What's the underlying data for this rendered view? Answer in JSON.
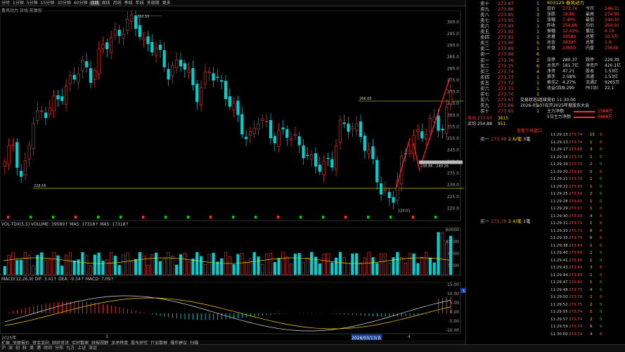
{
  "toolbar": {
    "items": [
      "分时",
      "1分钟",
      "5分钟",
      "15分钟",
      "30分钟",
      "60分钟",
      "日线",
      "周线",
      "月线",
      "季线",
      "年线",
      "多周期",
      "更多"
    ],
    "active": "日线"
  },
  "chart_title": "鲁风动力 日线 前复权",
  "price_axis": [
    "300.0",
    "295.0",
    "290.0",
    "285.0",
    "280.0",
    "275.0",
    "270.0",
    "265.0",
    "260.0",
    "255.0",
    "250.0",
    "245.0",
    "240.0",
    "235.0",
    "230.0",
    "225.0",
    "220.0"
  ],
  "annotations": {
    "high": "302.55",
    "low": "220.01",
    "level_266": "266.00",
    "level_228": "228.56",
    "range": "238.86 - 240.26"
  },
  "volume": {
    "header": "VOL-TDX(5,5) VOLUME: 39589↑  MA5: 17318↑  MA5: 17318↑",
    "axis": [
      "60000",
      "45000",
      "30000",
      "15000"
    ]
  },
  "macd": {
    "header": "MACD(12,26,9) DIF: 3.41↑  DEA: -0.54↑  MACD: 7.09↑",
    "axis": [
      "15.00",
      "10.00",
      "5.00",
      "0.00",
      "-5.00",
      "-10.00"
    ],
    "highlight": "5.56"
  },
  "dates": [
    "2025年",
    "3",
    "2026/03/13/五",
    "4"
  ],
  "tabs": [
    "扩展",
    "关联报价",
    "资金流向",
    "财经资讯",
    "实时数据",
    "财报视野",
    "龙虎榜单",
    "股东研究",
    "行业数据",
    "操作建议",
    "扫描"
  ],
  "header_right": {
    "code": "603129",
    "name": "春风动力"
  },
  "sell_orders": [
    {
      "label": "卖十",
      "price": "273.87",
      "vol": "1"
    },
    {
      "label": "卖九",
      "price": "273.86",
      "vol": "1"
    },
    {
      "label": "卖八",
      "price": "273.85",
      "vol": "3"
    },
    {
      "label": "卖七",
      "price": "273.95",
      "vol": "1"
    },
    {
      "label": "卖六",
      "price": "273.93",
      "vol": "1"
    },
    {
      "label": "卖五",
      "price": "273.92",
      "vol": "1"
    },
    {
      "label": "卖四",
      "price": "273.91",
      "vol": "1"
    },
    {
      "label": "卖三",
      "price": "273.90",
      "vol": "5"
    },
    {
      "label": "卖二",
      "price": "273.89",
      "vol": "1"
    },
    {
      "label": "卖一",
      "price": "273.88",
      "vol": "6"
    }
  ],
  "buy_orders": [
    {
      "label": "买一",
      "price": "273.76",
      "vol": "2"
    },
    {
      "label": "买二",
      "price": "273.75",
      "vol": "6"
    },
    {
      "label": "买三",
      "price": "273.74",
      "vol": "4"
    },
    {
      "label": "买四",
      "price": "273.73",
      "vol": "1"
    },
    {
      "label": "买五",
      "price": "273.72",
      "vol": "1"
    },
    {
      "label": "买六",
      "price": "273.71",
      "vol": "1"
    },
    {
      "label": "买七",
      "price": "273.70",
      "vol": "1"
    },
    {
      "label": "买八",
      "price": "273.67",
      "vol": "1"
    },
    {
      "label": "买九",
      "price": "273.66",
      "vol": "1"
    },
    {
      "label": "买十",
      "price": "273.65",
      "vol": "1"
    }
  ],
  "quote": [
    {
      "k": "现价",
      "v": "273.74",
      "k2": "今开",
      "v2": "246.31"
    },
    {
      "k": "涨跌",
      "v": "18.86",
      "k2": "最高",
      "v2": "274.99"
    },
    {
      "k": "涨幅",
      "v": "7.40%",
      "k2": "最低",
      "v2": "244.33"
    },
    {
      "k": "昨收",
      "v": "254.88",
      "k2": "均价",
      "v2": "264.91"
    },
    {
      "k": "振幅",
      "v": "12.43%",
      "k2": "量比",
      "v2": "6.19"
    },
    {
      "k": "总量",
      "v": "39589",
      "k2": "总笔",
      "v2": "10.5万"
    },
    {
      "k": "总金",
      "v": "28393",
      "k2": "总笔",
      "v2": "1.9"
    },
    {
      "k": "外盘",
      "v": "23950",
      "k2": "内盘",
      "v2": "15639"
    }
  ],
  "quote2": [
    {
      "k": "涨停",
      "v": "280.37",
      "k2": "跌停",
      "v2": "229.39"
    },
    {
      "k": "总资产",
      "v": "181.7亿",
      "k2": "净资产",
      "v2": "420.1亿"
    },
    {
      "k": "净资",
      "v": "47.21",
      "k2": "股本",
      "v2": "1.53亿"
    },
    {
      "k": "换手",
      "v": "2.58%",
      "k2": "流通",
      "v2": "1.53亿"
    },
    {
      "k": "换手Z",
      "v": "4.27%",
      "k2": "流通Z",
      "v2": "9265万"
    },
    {
      "k": "收益(四)",
      "v": "9.290",
      "k2": "PE(动)",
      "v2": "22.1"
    }
  ],
  "news": [
    "交易状态:连续竞价 11:30:00",
    "2026-05-07召开2025年度股东大会"
  ],
  "flow": [
    {
      "k": "主力净额",
      "v": "1588万"
    },
    {
      "k": "5日主力净额",
      "v": "6868万"
    }
  ],
  "summary": {
    "sell": "卖出 273.60",
    "sell_vol": "3615",
    "buy": "买均 254.88",
    "buy_vol": "951",
    "up": "↑",
    "tip": "查看千档盘口"
  },
  "level1": {
    "label": "卖一",
    "price": "273.88",
    "vol": "2.6/笔",
    "count": "3笔"
  },
  "level2": {
    "label": "买一",
    "price": "273.76",
    "vol": "2.4/笔",
    "count": "1笔"
  },
  "ticks": [
    {
      "t": "11:29:13",
      "p": "273.74",
      "v": "15",
      "d": "B"
    },
    {
      "t": "11:29:13",
      "p": "273.74",
      "v": "1",
      "d": "B"
    },
    {
      "t": "11:29:17",
      "p": "273.68",
      "v": "3",
      "d": "B"
    },
    {
      "t": "11:29:18",
      "p": "273.70",
      "v": "1",
      "d": "S"
    },
    {
      "t": "11:29:19",
      "p": "273.70",
      "v": "2",
      "d": "S"
    },
    {
      "t": "11:29:20",
      "p": "273.80",
      "v": "5",
      "d": "B"
    },
    {
      "t": "11:29:21",
      "p": "273.78",
      "v": "1",
      "d": "S"
    },
    {
      "t": "11:29:22",
      "p": "273.69",
      "v": "1",
      "d": "S"
    },
    {
      "t": "11:29:25",
      "p": "273.69",
      "v": "2",
      "d": "S"
    },
    {
      "t": "11:29:28",
      "p": "273.65",
      "v": "1",
      "d": "S"
    },
    {
      "t": "11:29:29",
      "p": "273.67",
      "v": "1",
      "d": "B"
    },
    {
      "t": "11:29:30",
      "p": "273.69",
      "v": "4",
      "d": "B"
    },
    {
      "t": "11:29:31",
      "p": "273.71",
      "v": "1",
      "d": "B"
    },
    {
      "t": "11:29:33",
      "p": "273.71",
      "v": "8",
      "d": "B"
    },
    {
      "t": "11:29:35",
      "p": "273.76",
      "v": "6",
      "d": "B"
    },
    {
      "t": "11:29:38",
      "p": "273.84",
      "v": "1",
      "d": "B"
    },
    {
      "t": "11:29:40",
      "p": "273.81",
      "v": "2",
      "d": "S"
    },
    {
      "t": "11:29:41",
      "p": "273.80",
      "v": "1",
      "d": "S"
    },
    {
      "t": "11:29:43",
      "p": "273.84",
      "v": "3",
      "d": "B"
    },
    {
      "t": "11:29:44",
      "p": "273.89",
      "v": "1",
      "d": "B"
    },
    {
      "t": "11:29:47",
      "p": "273.81",
      "v": "1",
      "d": "S"
    },
    {
      "t": "11:29:48",
      "p": "273.75",
      "v": "4",
      "d": "S"
    },
    {
      "t": "11:29:50",
      "p": "273.78",
      "v": "1",
      "d": "B"
    },
    {
      "t": "11:29:52",
      "p": "273.75",
      "v": "2",
      "d": "S"
    },
    {
      "t": "11:29:55",
      "p": "273.74",
      "v": "1",
      "d": "S"
    },
    {
      "t": "11:29:57",
      "p": "273.74",
      "v": "2",
      "d": "S"
    },
    {
      "t": "11:29:59",
      "p": "273.74",
      "v": "6",
      "d": "S"
    },
    {
      "t": "11:30:00",
      "p": "273.74",
      "v": "4",
      "d": "B"
    }
  ],
  "bottombar": [
    "沪",
    "深",
    "创",
    "科",
    "美",
    "港",
    "时间",
    "分布",
    "九方",
    "上证",
    "深证"
  ],
  "colors": {
    "up": "#ff3030",
    "down": "#00d0d0",
    "ma": "#ffd700",
    "grid": "#333333"
  }
}
